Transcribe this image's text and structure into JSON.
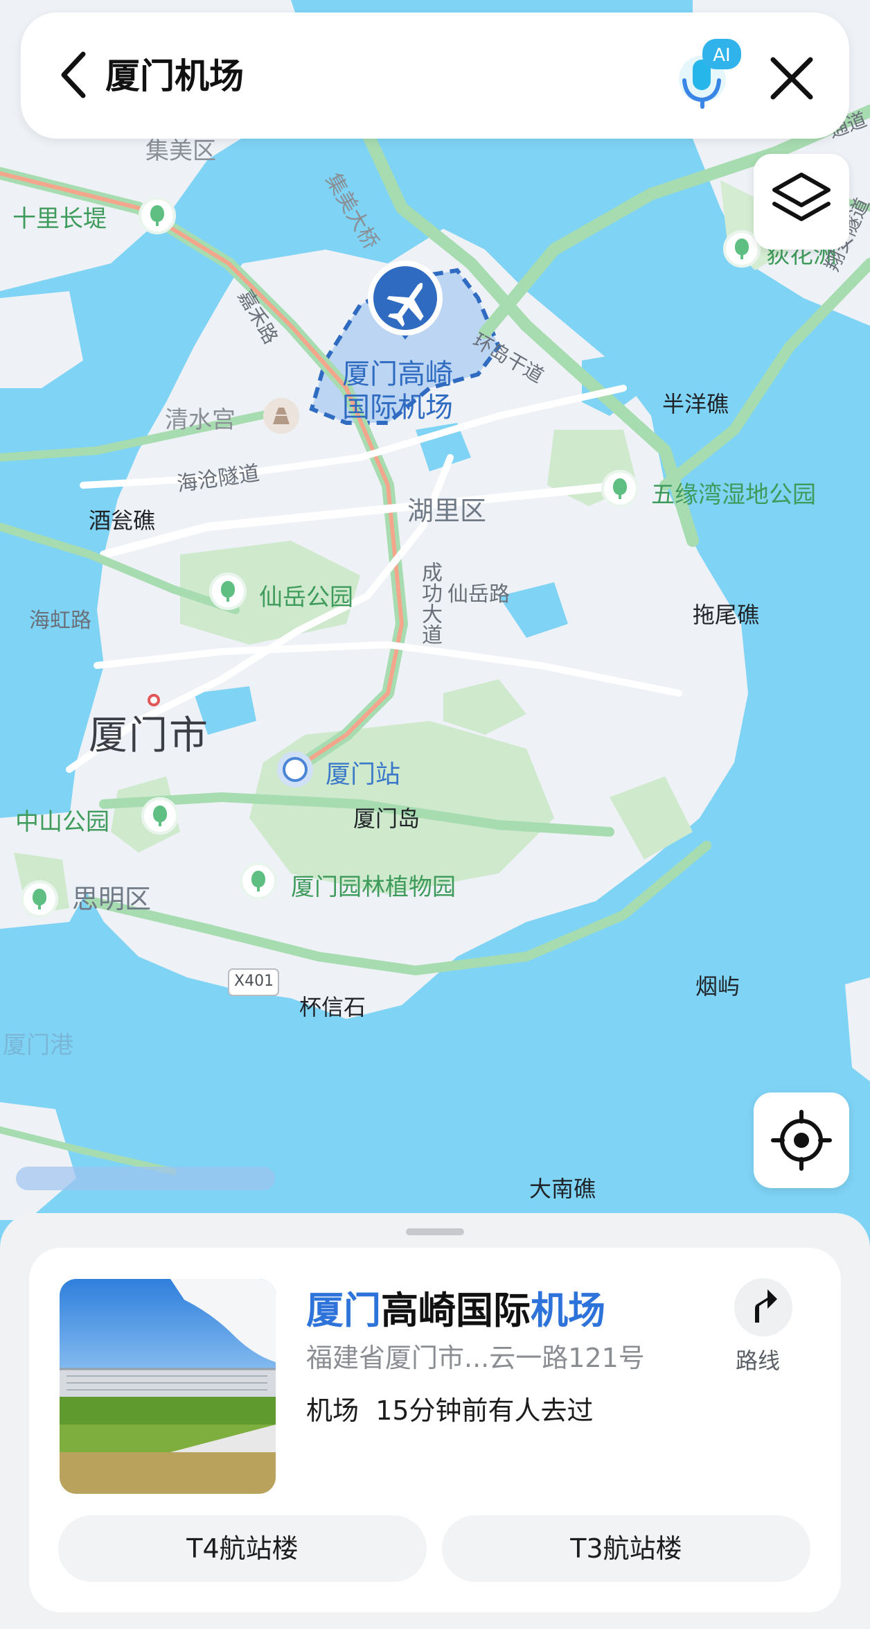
{
  "search": {
    "query": "厦门机场"
  },
  "map": {
    "labels": {
      "jimei_district": "集美区",
      "jimei_bridge": "集美大桥",
      "shilichangdi": "十里长堤",
      "dihuazhou": "荻花洲",
      "jiahe_road": "嘉禾路",
      "huandao_road": "环岛干道",
      "xiangan_tunnel": "翔安隧道",
      "tongdao": "通道",
      "qingshui_palace": "清水宫",
      "banyangjiao": "半洋礁",
      "haicang_tunnel": "海沧隧道",
      "huli_district": "湖里区",
      "jiuwengjiao": "酒瓮礁",
      "wuyuanwan_park": "五缘湾湿地公园",
      "chenggong_road": "成功大道",
      "xianyue_road": "仙岳路",
      "xianyue_park": "仙岳公园",
      "haihong_road": "海虹路",
      "tuoweijiao": "拖尾礁",
      "xiamen_city": "厦门市",
      "xiamen_station": "厦门站",
      "zhongshan_park": "中山公园",
      "xiamen_island": "厦门岛",
      "siming_district": "思明区",
      "botanical_garden": "厦门园林植物园",
      "x401": "X401",
      "beixinshi": "杯信石",
      "yanyu": "烟屿",
      "xiamen_port": "厦门港",
      "danan_jiao": "大南礁",
      "airport_line1": "厦门高崎",
      "airport_line2": "国际机场"
    }
  },
  "place": {
    "name_part1": "厦门",
    "name_part2": "高崎国际",
    "name_part3": "机场",
    "address": "福建省厦门市...云一路121号",
    "category": "机场",
    "activity": "15分钟前有人去过",
    "route_label": "路线",
    "chips": [
      "T4航站楼",
      "T3航站楼"
    ]
  },
  "colors": {
    "water": "#7fd3f5",
    "land": "#eef2f6",
    "green": "#cfe9cd",
    "accent_blue": "#2d73d9"
  }
}
